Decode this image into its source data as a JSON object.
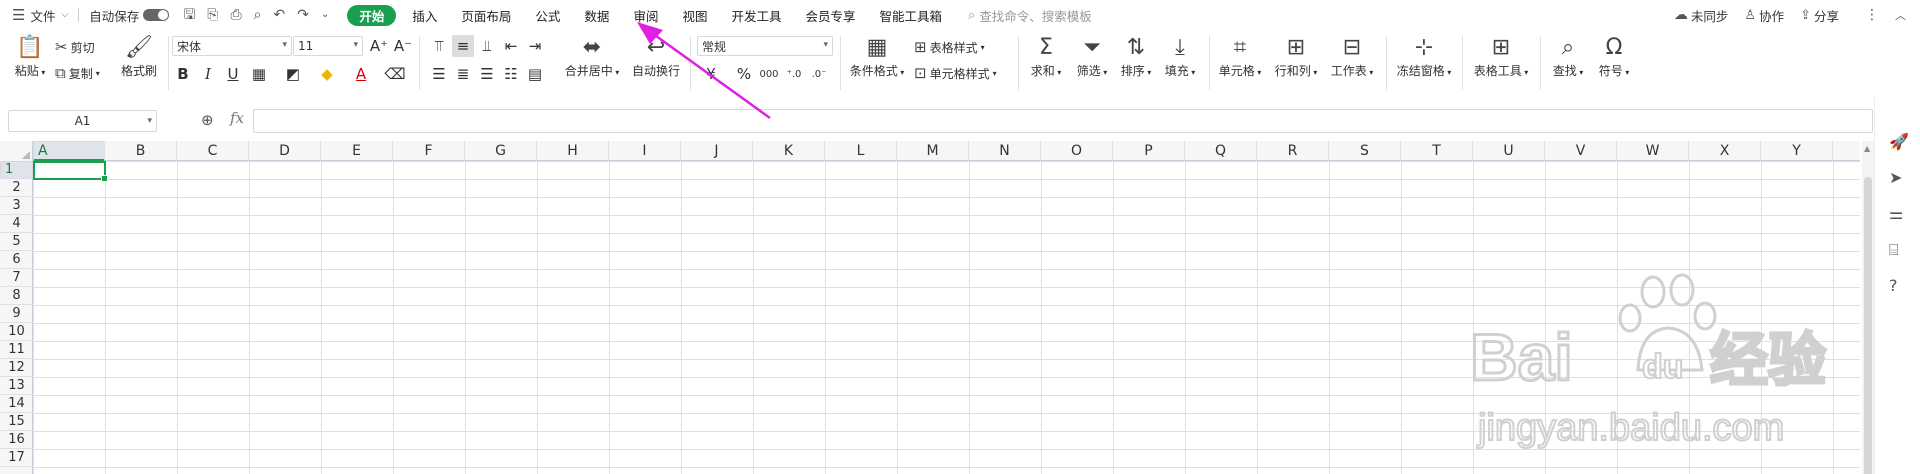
{
  "menubar": {
    "file_menu": "文件",
    "autosave": "自动保存",
    "tabs": [
      "开始",
      "插入",
      "页面布局",
      "公式",
      "数据",
      "审阅",
      "视图",
      "开发工具",
      "会员专享",
      "智能工具箱"
    ],
    "active_tab": "开始",
    "search_placeholder": "查找命令、搜索模板",
    "sync": "未同步",
    "collab": "协作",
    "share": "分享"
  },
  "ribbon": {
    "paste": "粘贴",
    "cut": "剪切",
    "copy": "复制",
    "format_painter": "格式刷",
    "font_name": "宋体",
    "font_size": "11",
    "bold": "B",
    "italic": "I",
    "underline": "U",
    "merge_center": "合并居中",
    "wrap_text": "自动换行",
    "number_format": "常规",
    "currency": "¥",
    "percent": "%",
    "thousands": "000",
    "conditional_format": "条件格式",
    "table_style": "表格样式",
    "cell_style": "单元格样式",
    "sum": "求和",
    "filter": "筛选",
    "sort": "排序",
    "fill": "填充",
    "cells": "单元格",
    "rows_cols": "行和列",
    "worksheet": "工作表",
    "freeze": "冻结窗格",
    "table_tools": "表格工具",
    "find": "查找",
    "symbol": "符号"
  },
  "formula_bar": {
    "name_box": "A1",
    "fx": "fx",
    "formula": ""
  },
  "grid": {
    "columns": [
      "A",
      "B",
      "C",
      "D",
      "E",
      "F",
      "G",
      "H",
      "I",
      "J",
      "K",
      "L",
      "M",
      "N",
      "O",
      "P",
      "Q",
      "R",
      "S",
      "T",
      "U",
      "V",
      "W",
      "X",
      "Y"
    ],
    "rows": [
      "1",
      "2",
      "3",
      "4",
      "5",
      "6",
      "7",
      "8",
      "9",
      "10",
      "11",
      "12",
      "13",
      "14",
      "15",
      "16",
      "17"
    ],
    "selected_cell": "A1"
  },
  "watermark": {
    "brand_latin": "Bai",
    "brand_du": "du",
    "brand_cn": "经验",
    "url": "jingyan.baidu.com"
  },
  "colors": {
    "accent": "#1a9e50",
    "annotation_arrow": "#e020e0",
    "grid_line": "#d9def0"
  }
}
